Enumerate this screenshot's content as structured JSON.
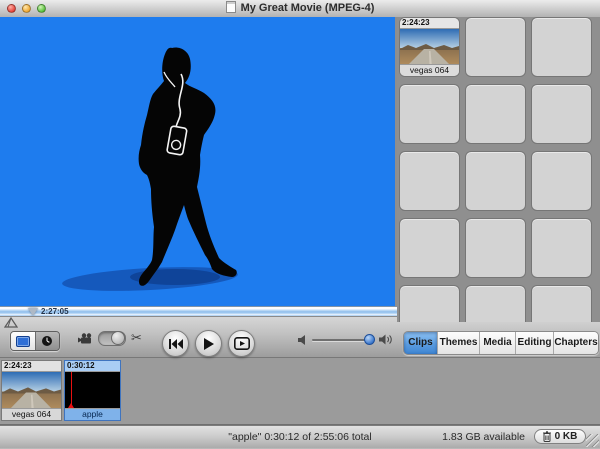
{
  "window": {
    "title": "My Great Movie (MPEG-4)"
  },
  "monitor": {
    "playhead_time": "2:27:05"
  },
  "clips_pane": {
    "clips": [
      {
        "duration": "2:24:23",
        "name": "vegas 064"
      }
    ],
    "empty_cell_count": 14,
    "tabs": [
      {
        "label": "Clips",
        "selected": true
      },
      {
        "label": "Themes",
        "selected": false
      },
      {
        "label": "Media",
        "selected": false
      },
      {
        "label": "Editing",
        "selected": false
      },
      {
        "label": "Chapters",
        "selected": false
      }
    ]
  },
  "timeline": {
    "clips": [
      {
        "duration": "2:24:23",
        "name": "vegas 064",
        "selected": false
      },
      {
        "duration": "0:30:12",
        "name": "apple",
        "selected": true
      }
    ]
  },
  "statusbar": {
    "selection_info": "\"apple\"  0:30:12 of 2:55:06 total",
    "disk_available": "1.83 GB available",
    "trash_size": "0 KB"
  },
  "icons": {
    "scissors_glyph": "✂"
  },
  "colors": {
    "video_blue": "#1e7cee",
    "selected_tab_blue": "#4a90d8",
    "timeline_selection_blue": "#7fb2ea",
    "playhead_red": "#e81010"
  }
}
